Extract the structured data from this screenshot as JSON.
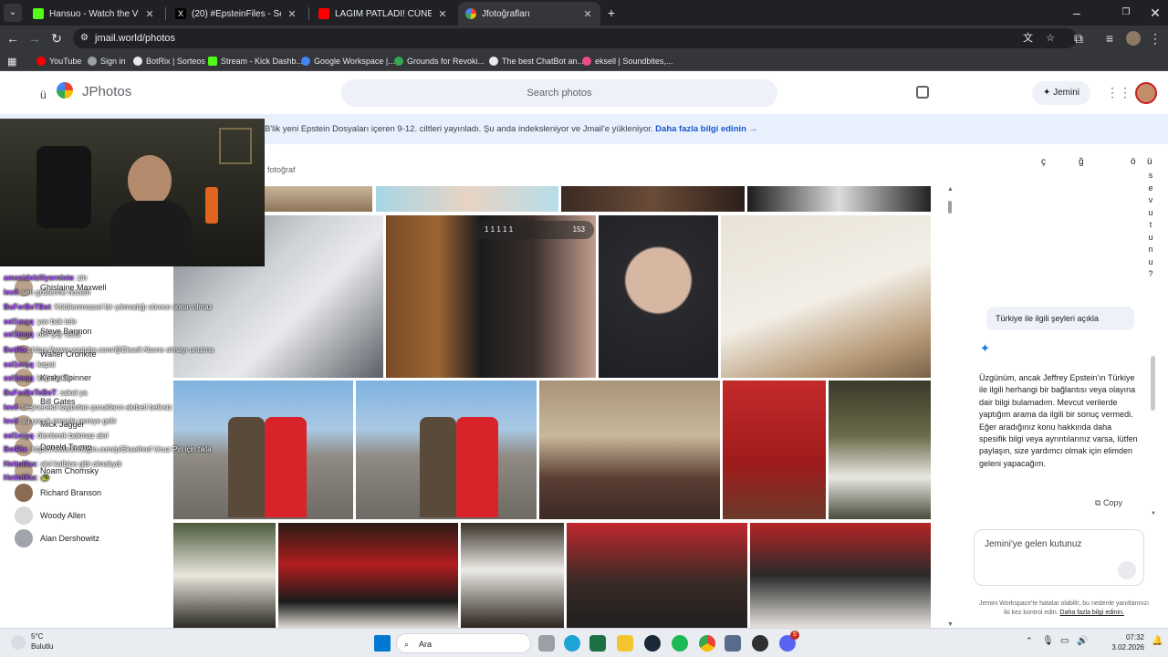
{
  "browser": {
    "tabs": [
      {
        "title": "Hansuo - Watch the VOD on Ki",
        "color": "#53fc18"
      },
      {
        "title": "(20) #EpsteinFiles - Search / X",
        "color": "#e8eaed"
      },
      {
        "title": "LAĞIM PATLADI! CÜNEYT ÖZDE",
        "color": "#ff0000"
      },
      {
        "title": "Jfotoğrafları",
        "color": "#f4b400"
      }
    ],
    "new_tab_glyph": "+",
    "url": "jmail.world/photos",
    "bookmarks": [
      {
        "label": "YouTube",
        "color": "#ff0000"
      },
      {
        "label": "Sign in",
        "color": "#9aa0a6"
      },
      {
        "label": "BotRix | Sorteos",
        "color": "#e8eaed"
      },
      {
        "label": "Stream - Kick Dashb...",
        "color": "#53fc18"
      },
      {
        "label": "Google Workspace |...",
        "color": "#4285f4"
      },
      {
        "label": "Grounds for Revoki...",
        "color": "#34a853"
      },
      {
        "label": "The best ChatBot an...",
        "color": "#e8eaed"
      },
      {
        "label": "eksell | Soundbites,...",
        "color": "#ea4c89"
      }
    ]
  },
  "app": {
    "menu_glyph": "ü",
    "brand": "JPhotos",
    "search_placeholder": "Search photos",
    "user_button": "Jemini",
    "banner_text": "B'lik yeni Epstein Dosyaları içeren 9-12. ciltleri yayınladı. Şu anda indeksleniyor ve Jmail'e yükleniyor. ",
    "banner_link": "Daha fazla bilgi edinin →",
    "photo_count_label": "fotoğraf",
    "photo_badge": "153",
    "photo_badge_ticks": "1   1   1   1   1",
    "people": [
      {
        "name": "Ghislaine Maxwell"
      },
      {
        "name": "Walter Cronkite"
      },
      {
        "name": "Steve Bannon"
      },
      {
        "name": "Kirsty Spinner"
      },
      {
        "name": "Bill Gates"
      },
      {
        "name": "Mick Jagger"
      },
      {
        "name": "Donald Trump"
      },
      {
        "name": "Noam Chomsky"
      },
      {
        "name": "Richard Branson"
      },
      {
        "name": "Woody Allen"
      },
      {
        "name": "Alan Dershowitz"
      }
    ]
  },
  "chat_overlay": [
    {
      "user": "amanidelziliyorniste",
      "text": ": zin"
    },
    {
      "user": "levil",
      "text": ": sen gösterme hocam"
    },
    {
      "user": "BuFerBeTBot",
      "text": ": Kötülenmezsel bir çıkmadığı sürece sorun olmaz"
    },
    {
      "user": "sel1mqq",
      "text": ": yav bak tele"
    },
    {
      "user": "sel1mqq",
      "text": ": olm şey vardı"
    },
    {
      "user": "BotRix",
      "text": ": https://www.youtube.com/@Eksell Abone olmayı unutma"
    },
    {
      "user": "sel1mqq",
      "text": ": kapat"
    },
    {
      "user": "sel1mqq",
      "text": ": kırpı bekle"
    },
    {
      "user": "BuFerBeTeBoT",
      "text": ": sakal ya"
    },
    {
      "user": "levil",
      "text": ": beşinerekti kaybolan çocukların akıbeti belirsiz"
    },
    {
      "user": "levil",
      "text": ": şu çocuk mesela nereye gelir"
    },
    {
      "user": "sel1mqq",
      "text": ": ölenlerek bakmaz akıl"
    },
    {
      "user": "BotRix",
      "text": ": https://www.knowpin.com/p/Ekselhref Ucuz Pin için tıkla"
    },
    {
      "user": "HettoMax",
      "text": ": akıl kalbine gibi olmalıydı"
    },
    {
      "user": "HettoMax",
      "text": ": 🐢"
    }
  ],
  "jemini": {
    "side_letters": [
      "ç",
      "ğ",
      "ö",
      "ü"
    ],
    "vertical_text": [
      "s",
      "e",
      "v",
      "u",
      "t",
      "u",
      "n",
      "u",
      "?"
    ],
    "user_message": "Türkiye ile ilgili şeyleri açıkla",
    "reply": "Üzgünüm, ancak Jeffrey Epstein'ın Türkiye ile ilgili herhangi bir bağlantısı veya olayına dair bilgi bulamadım. Mevcut verilerde yaptığım arama da ilgili bir sonuç vermedi. Eğer aradığınız konu hakkında daha spesifik bilgi veya ayrıntılarınız varsa, lütfen paylaşın, size yardımcı olmak için elimden geleni yapacağım.",
    "copy_label": "Copy",
    "input_placeholder": "Jemini'ye gelen kutunuz",
    "disclaimer": "Jemini Workspace'te hatalar olabilir, bu nedenle yanıtlarınızı iki kez kontrol edin. ",
    "disclaimer_link": "Daha fazla bilgi edinin."
  },
  "taskbar": {
    "weather_temp": "5°C",
    "weather_desc": "Bulutlu",
    "search_label": "Ara",
    "time": "07:32",
    "date": "3.02.2026",
    "badge": "5"
  }
}
